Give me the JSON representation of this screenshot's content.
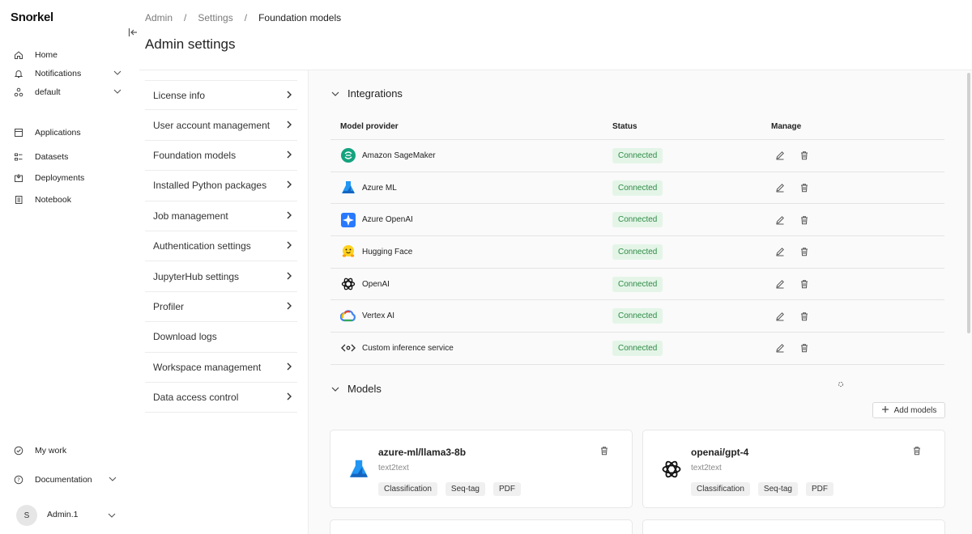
{
  "app": {
    "logo": "Snorkel"
  },
  "sidebar": {
    "items": [
      {
        "label": "Home",
        "icon": "home-icon"
      },
      {
        "label": "Notifications",
        "icon": "bell-icon"
      },
      {
        "label": "default",
        "icon": "workspace-icon"
      },
      {
        "label": "Applications",
        "icon": "applications-icon"
      },
      {
        "label": "Datasets",
        "icon": "datasets-icon"
      },
      {
        "label": "Deployments",
        "icon": "deployments-icon"
      },
      {
        "label": "Notebook",
        "icon": "notebook-icon"
      }
    ],
    "bottom": [
      {
        "label": "My work",
        "icon": "check-circle-icon"
      },
      {
        "label": "Documentation",
        "icon": "help-icon"
      }
    ],
    "user": {
      "initial": "S",
      "name": "Admin.1"
    }
  },
  "breadcrumb": {
    "items": [
      "Admin",
      "/",
      "Settings",
      "/",
      "Foundation models"
    ]
  },
  "page": {
    "title": "Admin settings"
  },
  "menu": {
    "items": [
      "License info",
      "User account management",
      "Foundation models",
      "Installed Python packages",
      "Job management",
      "Authentication settings",
      "JupyterHub settings",
      "Profiler",
      "Download logs",
      "Workspace management",
      "Data access control"
    ]
  },
  "integrations": {
    "title": "Integrations",
    "columns": {
      "provider": "Model provider",
      "status": "Status",
      "manage": "Manage"
    },
    "rows": [
      {
        "provider": "Amazon SageMaker",
        "status": "Connected",
        "icon": "sagemaker-icon"
      },
      {
        "provider": "Azure ML",
        "status": "Connected",
        "icon": "azure-ml-icon"
      },
      {
        "provider": "Azure OpenAI",
        "status": "Connected",
        "icon": "azure-openai-icon"
      },
      {
        "provider": "Hugging Face",
        "status": "Connected",
        "icon": "hugging-face-icon"
      },
      {
        "provider": "OpenAI",
        "status": "Connected",
        "icon": "openai-icon"
      },
      {
        "provider": "Vertex AI",
        "status": "Connected",
        "icon": "vertex-ai-icon"
      },
      {
        "provider": "Custom inference service",
        "status": "Connected",
        "icon": "code-icon"
      }
    ]
  },
  "models": {
    "title": "Models",
    "add_label": "Add models",
    "cards": [
      {
        "name": "azure-ml/llama3-8b",
        "type": "text2text",
        "tags": [
          "Classification",
          "Seq-tag",
          "PDF"
        ],
        "icon": "azure-ml-icon"
      },
      {
        "name": "openai/gpt-4",
        "type": "text2text",
        "tags": [
          "Classification",
          "Seq-tag",
          "PDF"
        ],
        "icon": "openai-icon"
      }
    ]
  },
  "colors": {
    "connected_bg": "#e4f5e8",
    "connected_text": "#2f8a45",
    "azure_blue": "#1e88e5"
  }
}
